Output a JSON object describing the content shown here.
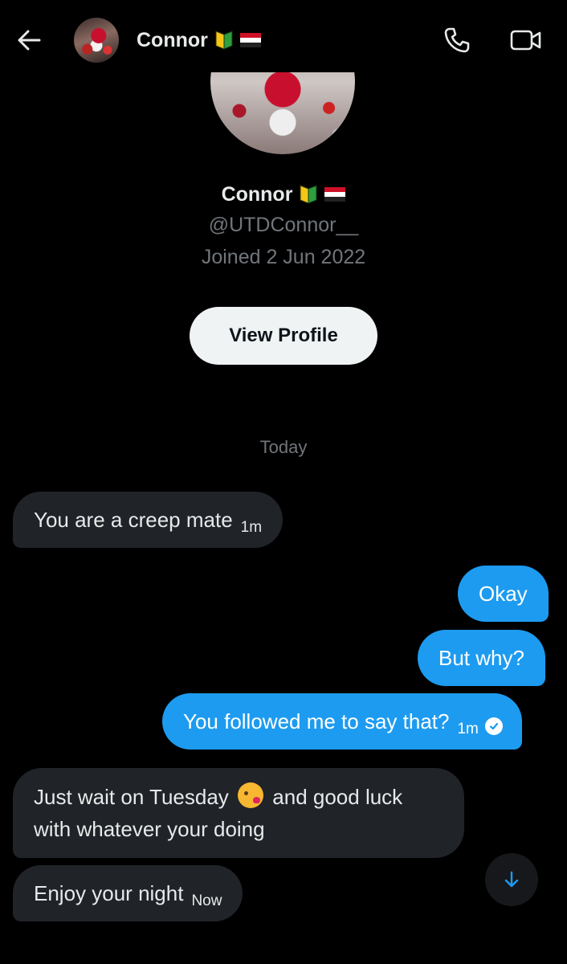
{
  "header": {
    "back_icon": "arrow-left-icon",
    "name": "Connor",
    "badges": [
      "japanese-beginner-symbol-icon",
      "yemen-flag-icon"
    ],
    "phone_icon": "phone-icon",
    "video_icon": "video-camera-icon"
  },
  "profile": {
    "name": "Connor",
    "handle": "@UTDConnor__",
    "joined": "Joined 2 Jun 2022",
    "view_profile_label": "View Profile"
  },
  "conversation": {
    "day_label": "Today",
    "messages": [
      {
        "direction": "incoming",
        "text": "You are a creep mate",
        "time": "1m"
      },
      {
        "direction": "outgoing",
        "text": "Okay",
        "time": ""
      },
      {
        "direction": "outgoing",
        "text": "But why?",
        "time": ""
      },
      {
        "direction": "outgoing",
        "text": "You followed me to say that?",
        "time": "1m",
        "status": "seen"
      },
      {
        "direction": "incoming",
        "text_before_emoji": "Just wait on Tuesday",
        "emoji": "face-blowing-a-kiss",
        "text_after_emoji": "and good luck with whatever your doing",
        "time": ""
      },
      {
        "direction": "incoming",
        "text": "Enjoy your night",
        "time": "Now"
      }
    ]
  },
  "scroll_button_icon": "arrow-down-icon",
  "colors": {
    "background": "#000000",
    "incoming_bubble": "#202327",
    "outgoing_bubble": "#1d9bf0",
    "muted_text": "#71767b",
    "primary_text": "#e7e9ea"
  }
}
